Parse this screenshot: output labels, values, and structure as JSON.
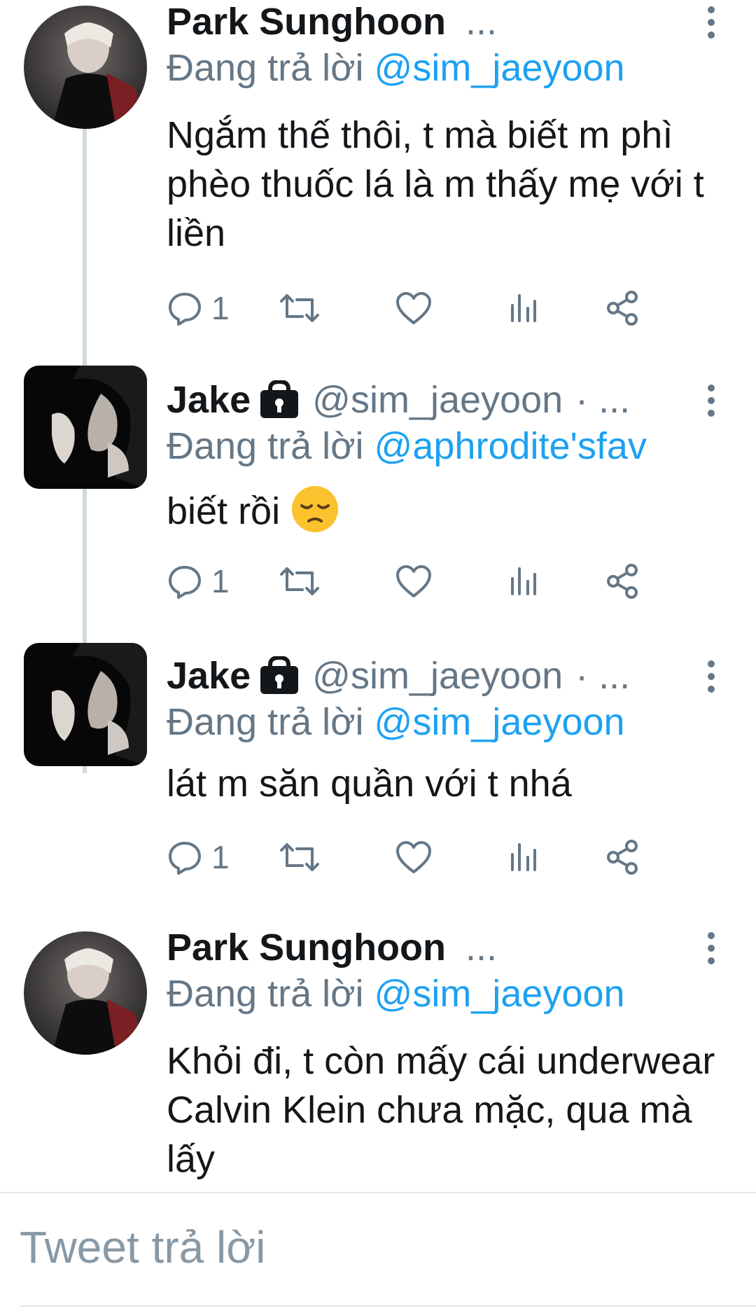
{
  "tweets": [
    {
      "name": "Park Sunghoon",
      "handle": "",
      "more": "...",
      "replying_prefix": "Đang trả lời",
      "replying_to": "@sim_jaeyoon",
      "text": "Ngắm thế thôi, t mà biết m phì phèo thuốc lá là m thấy mẹ với t liền",
      "reply_count": "1",
      "locked": false
    },
    {
      "name": "Jake",
      "handle": "@sim_jaeyoon",
      "more": "· ...",
      "replying_prefix": "Đang trả lời",
      "replying_to": "@aphrodite'sfav",
      "text": "biết rồi",
      "reply_count": "1",
      "locked": true
    },
    {
      "name": "Jake",
      "handle": "@sim_jaeyoon",
      "more": "· ...",
      "replying_prefix": "Đang trả lời",
      "replying_to": "@sim_jaeyoon",
      "text": "lát m săn quần với t nhá",
      "reply_count": "1",
      "locked": true
    },
    {
      "name": "Park Sunghoon",
      "handle": "",
      "more": "...",
      "replying_prefix": "Đang trả lời",
      "replying_to": "@sim_jaeyoon",
      "text": "Khỏi đi, t còn mấy cái underwear Calvin Klein chưa mặc, qua mà lấy",
      "locked": false
    }
  ],
  "compose": {
    "placeholder": "Tweet trả lời"
  },
  "icons": {
    "reply": "reply-icon",
    "retweet": "retweet-icon",
    "like": "heart-icon",
    "analytics": "analytics-icon",
    "share": "share-icon",
    "more": "more-vertical-icon",
    "lock": "lock-icon",
    "emoji": "pensive-face-emoji"
  },
  "colors": {
    "mention": "#1da1f2",
    "secondary_text": "#657786",
    "icon": "#657786",
    "thread_line": "#cfd9de"
  }
}
